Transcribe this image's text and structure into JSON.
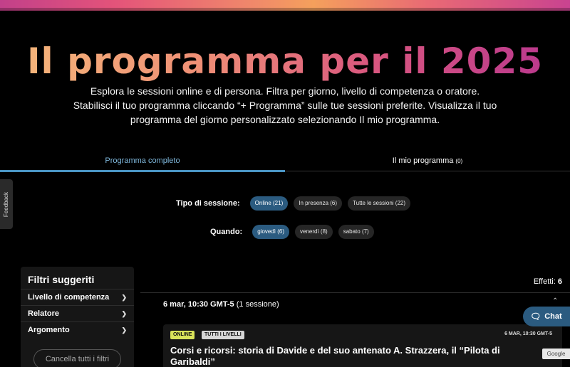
{
  "hero": {
    "title": "Il programma per il 2025",
    "description": "Esplora le sessioni online e di persona. Filtra per giorno, livello di competenza o oratore. Stabilisci il tuo programma cliccando “+ Programma” sulle tue sessioni preferite. Visualizza il tuo programma del giorno personalizzato selezionando Il mio programma."
  },
  "tabs": {
    "full": "Programma completo",
    "mine": "Il mio programma",
    "mine_count": "(0)"
  },
  "session_type": {
    "label": "Tipo di sessione:",
    "chips": [
      "Online (21)",
      "In presenza (6)",
      "Tutte le sessioni (22)"
    ]
  },
  "when": {
    "label": "Quando:",
    "chips": [
      "giovedì (6)",
      "venerdì (8)",
      "sabato (7)"
    ]
  },
  "feedback": {
    "label": "Feedback"
  },
  "sidebar": {
    "title": "Filtri suggeriti",
    "items": [
      "Livello di competenza",
      "Relatore",
      "Argomento"
    ],
    "clear": "Cancella tutti i filtri"
  },
  "results": {
    "effects_label": "Effetti:",
    "effects_count": "6",
    "group_date": "6 mar, 10:30 GMT-5",
    "group_count": "(1 sessione)"
  },
  "card": {
    "badge_mode": "ONLINE",
    "badge_level": "TUTTI I LIVELLI",
    "time": "6 MAR, 10:30 GMT-5",
    "title": "Corsi e ricorsi: storia di Davide e del suo antenato A. Strazzera, il “Pilota di Garibaldi”"
  },
  "chat": {
    "label": "Chat",
    "icon": "chat-bubbles-icon"
  },
  "google": {
    "label": "Google"
  },
  "colors": {
    "accent": "#2b5b80",
    "tab_active": "#7fb8dd",
    "badge_online": "#d9e35a"
  }
}
